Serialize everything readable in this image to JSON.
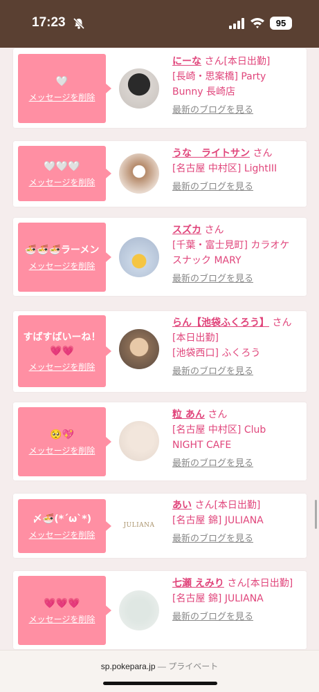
{
  "status": {
    "time": "17:23",
    "battery": "95"
  },
  "browser": {
    "url": "sp.pokepara.jp",
    "mode": "— プライベート"
  },
  "common": {
    "delete_label": "メッセージを削除",
    "blog_label": "最新のブログを見る",
    "san": "さん"
  },
  "cards": [
    {
      "message": "🤍",
      "name": "にーな",
      "suffix": "[本日出勤]",
      "location": "[長崎・思案橋] Party Bunny 長崎店"
    },
    {
      "message": "🤍🤍🤍",
      "name": "うな　ライトサン",
      "suffix": "",
      "location": "[名古屋 中村区] LightIII"
    },
    {
      "message": "🍜🍜🍜ラーメン",
      "name": "スズカ",
      "suffix": "",
      "location": "[千葉・富士見町] カラオケスナック MARY"
    },
    {
      "message": "すばすばいーね！💗💗",
      "name": "らん【池袋ふくろう】",
      "suffix": "[本日出勤]",
      "location": "[池袋西口] ふくろう"
    },
    {
      "message": "🥺💖",
      "name": "粒 あん",
      "suffix": "",
      "location": "[名古屋 中村区] Club NIGHT CAFE"
    },
    {
      "message": "〆🍜(*´ω`*)",
      "name": "あい",
      "suffix": "[本日出勤]",
      "location": "[名古屋 錦] JULIANA"
    },
    {
      "message": "💗💗💗",
      "name": "七瀬 えみり",
      "suffix": "[本日出勤]",
      "location": "[名古屋 錦] JULIANA"
    }
  ],
  "avatar_texts": {
    "juliana": "JULIANA"
  },
  "colors": {
    "bubble": "#ff8fa3",
    "accent": "#e0457b",
    "statusbar": "#5a4032"
  }
}
